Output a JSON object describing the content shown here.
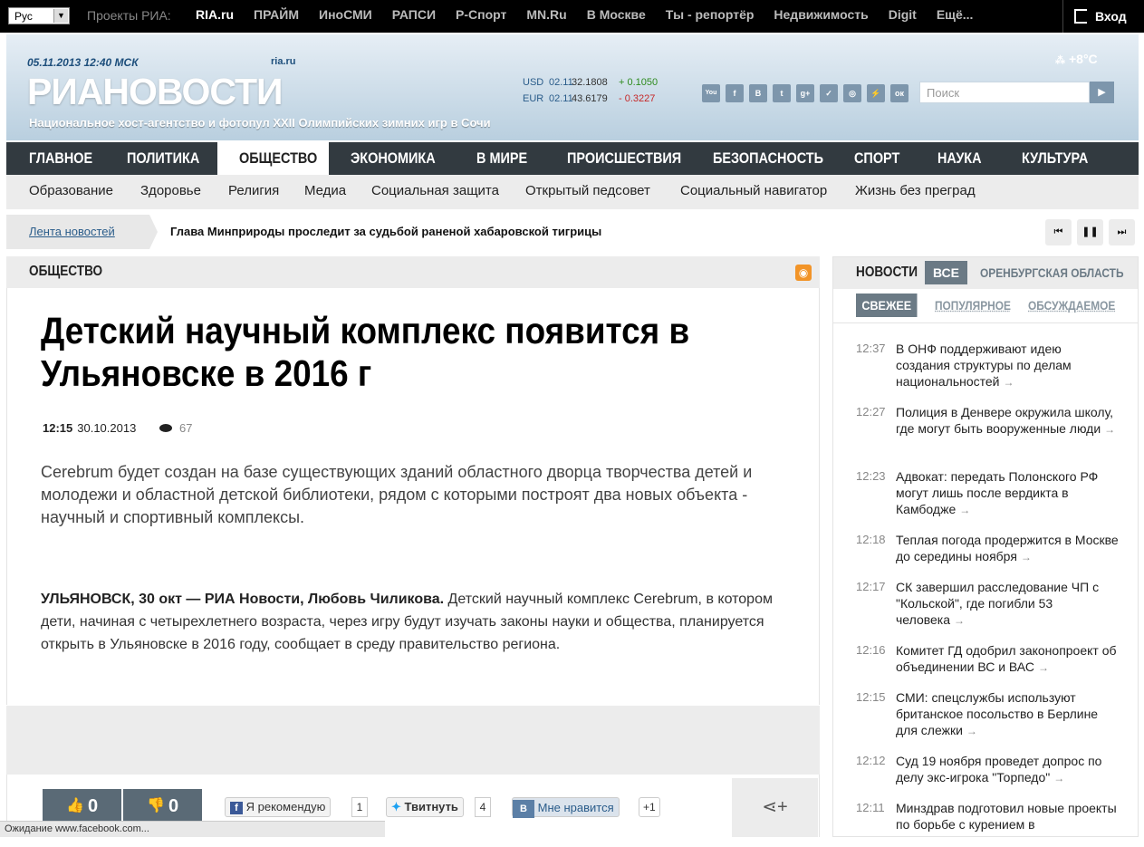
{
  "topbar": {
    "lang": "Рус",
    "projects_label": "Проекты РИА:",
    "projects": [
      "RIA.ru",
      "ПРАЙМ",
      "ИноСМИ",
      "РАПСИ",
      "Р-Спорт",
      "MN.Ru",
      "В Москве",
      "Ты - репортёр",
      "Недвижимость",
      "Digit",
      "Ещё..."
    ],
    "login": "Вход"
  },
  "header": {
    "date": "05.11.2013  12:40 МСК",
    "ria_small": "ria.ru",
    "logo": "РИАНОВОСТИ",
    "slogan": "Национальное хост-агентство и фотопул XXII Олимпийских зимних игр в Сочи",
    "weather": "+8°C",
    "search_placeholder": "Поиск",
    "rates": [
      {
        "cur": "USD",
        "date": "02.11",
        "value": "32.1808",
        "change": "+ 0.1050",
        "dir": "up"
      },
      {
        "cur": "EUR",
        "date": "02.11",
        "value": "43.6179",
        "change": "- 0.3227",
        "dir": "down"
      }
    ],
    "socials": [
      "YouTube",
      "f",
      "В",
      "t",
      "g+",
      "✓",
      "◎",
      "⚡",
      "ок"
    ]
  },
  "main_nav": [
    "Главное",
    "Политика",
    "Общество",
    "Экономика",
    "В мире",
    "Происшествия",
    "Безопасность",
    "Спорт",
    "Наука",
    "Культура"
  ],
  "sub_nav": [
    "Образование",
    "Здоровье",
    "Религия",
    "Медиа",
    "Социальная защита",
    "Открытый педсовет",
    "Социальный навигатор",
    "Жизнь без преград"
  ],
  "ticker": {
    "label": "Лента новостей",
    "text": "Глава Минприроды проследит за судьбой раненой хабаровской тигрицы"
  },
  "section": "Общество",
  "article": {
    "title": "Детский научный комплекс появится в Ульяновске в 2016 г",
    "time": "12:15",
    "date": "30.10.2013",
    "views": "67",
    "lead": "Cerebrum будет создан на базе существующих зданий областного дворца творчества детей и молодежи и областной детской библиотеки, рядом с которыми построят два новых объекта - научный и спортивный комплексы.",
    "dateline": "УЛЬЯНОВСК, 30 окт — РИА Новости, Любовь Чиликова.",
    "body": " Детский научный комплекс Cerebrum, в котором дети, начиная с четырехлетнего возраста, через игру будут изучать законы науки и общества, планируется открыть в Ульяновске в 2016 году, сообщает в среду правительство региона."
  },
  "actions": {
    "likes": "0",
    "dislikes": "0",
    "fb_label": "Я рекомендую",
    "fb_count": "1",
    "tw_label": "Твитнуть",
    "tw_count": "4",
    "vk_label": "Мне нравится",
    "gp_label": "+1"
  },
  "status": "Ожидание www.facebook.com...",
  "sidebar": {
    "title": "Новости",
    "all": "Все",
    "region": "Оренбургская область",
    "filters": [
      "Свежее",
      "Популярное",
      "Обсуждаемое"
    ],
    "news": [
      {
        "time": "12:37",
        "text": "В ОНФ поддерживают идею создания структуры по делам национальностей"
      },
      {
        "time": "12:27",
        "text": "Полиция в Денвере окружила школу, где могут быть вооруженные люди"
      },
      {
        "time": "12:23",
        "text": "Адвокат: передать Полонского РФ могут лишь после вердикта в Камбодже"
      },
      {
        "time": "12:18",
        "text": "Теплая погода продержится в Москве до середины ноября"
      },
      {
        "time": "12:17",
        "text": "СК завершил расследование ЧП с \"Кольской\", где погибли 53 человека"
      },
      {
        "time": "12:16",
        "text": "Комитет ГД одобрил законопроект об объединении ВС и ВАС"
      },
      {
        "time": "12:15",
        "text": "СМИ: спецслужбы используют британское посольство в Берлине для слежки"
      },
      {
        "time": "12:12",
        "text": "Суд 19 ноября проведет допрос по делу экс-игрока \"Торпедо\""
      },
      {
        "time": "12:11",
        "text": "Минздрав подготовил новые проекты по борьбе с курением в"
      }
    ]
  }
}
